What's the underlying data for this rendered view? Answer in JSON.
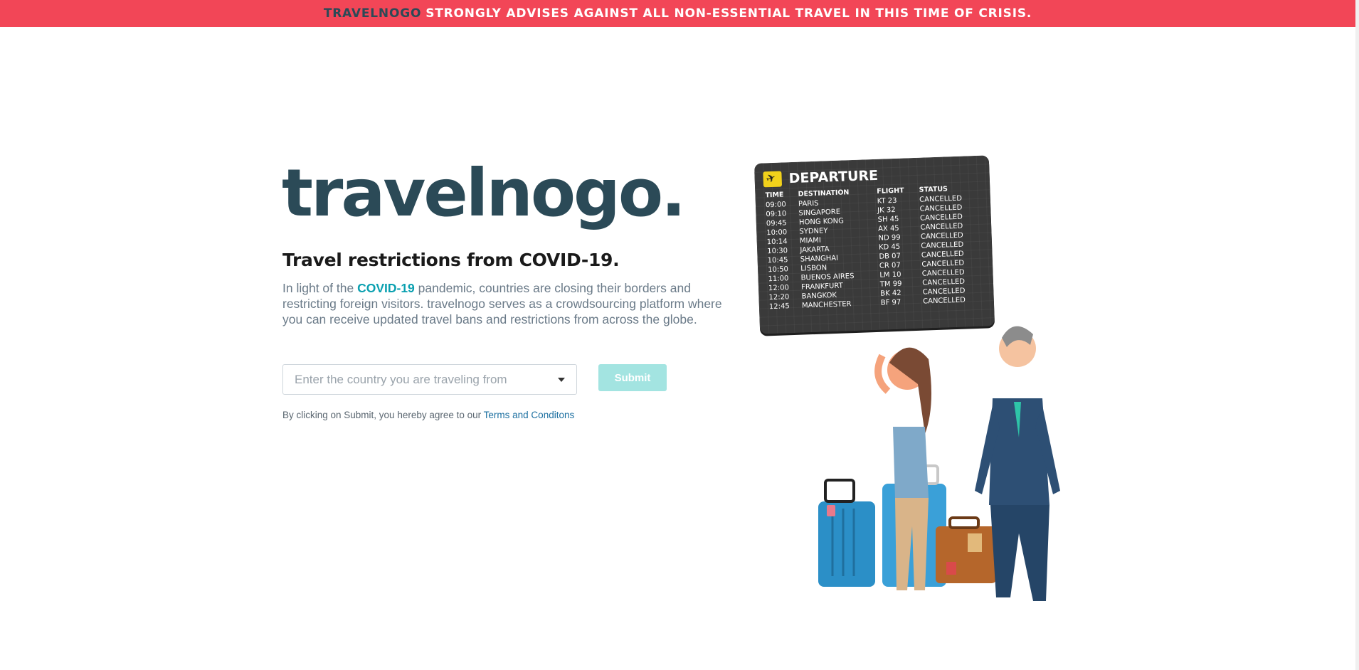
{
  "banner": {
    "brand": "TRAVELNOGO",
    "message": "STRONGLY ADVISES AGAINST ALL NON-ESSENTIAL TRAVEL IN THIS TIME OF CRISIS."
  },
  "hero": {
    "logo": "travelnogo.",
    "subtitle": "Travel restrictions from COVID-19.",
    "desc_prefix": "In light of the ",
    "desc_highlight": "COVID-19",
    "desc_suffix": " pandemic, countries are closing their borders and restricting foreign visitors. travelnogo serves as a crowdsourcing platform where you can receive updated travel bans and restrictions from across the globe."
  },
  "form": {
    "select_placeholder": "Enter the country you are traveling from",
    "submit_label": "Submit",
    "terms_prefix": "By clicking on Submit, you hereby agree to our ",
    "terms_link": "Terms and Conditons"
  },
  "board": {
    "title": "DEPARTURE",
    "headers": [
      "TIME",
      "DESTINATION",
      "FLIGHT",
      "STATUS"
    ],
    "rows": [
      [
        "09:00",
        "PARIS",
        "KT 23",
        "CANCELLED"
      ],
      [
        "09:10",
        "SINGAPORE",
        "JK 32",
        "CANCELLED"
      ],
      [
        "09:45",
        "HONG KONG",
        "SH 45",
        "CANCELLED"
      ],
      [
        "10:00",
        "SYDNEY",
        "AX 45",
        "CANCELLED"
      ],
      [
        "10:14",
        "MIAMI",
        "ND 99",
        "CANCELLED"
      ],
      [
        "10:30",
        "JAKARTA",
        "KD 45",
        "CANCELLED"
      ],
      [
        "10:45",
        "SHANGHAI",
        "DB 07",
        "CANCELLED"
      ],
      [
        "10:50",
        "LISBON",
        "CR 07",
        "CANCELLED"
      ],
      [
        "11:00",
        "BUENOS AIRES",
        "LM 10",
        "CANCELLED"
      ],
      [
        "12:00",
        "FRANKFURT",
        "TM 99",
        "CANCELLED"
      ],
      [
        "12:20",
        "BANGKOK",
        "BK 42",
        "CANCELLED"
      ],
      [
        "12:45",
        "MANCHESTER",
        "BF 97",
        "CANCELLED"
      ]
    ]
  },
  "colors": {
    "banner_bg": "#f24657",
    "brand_dark": "#2b4a57",
    "accent_teal": "#0aa0b0",
    "submit_bg": "#a3e4e1"
  }
}
